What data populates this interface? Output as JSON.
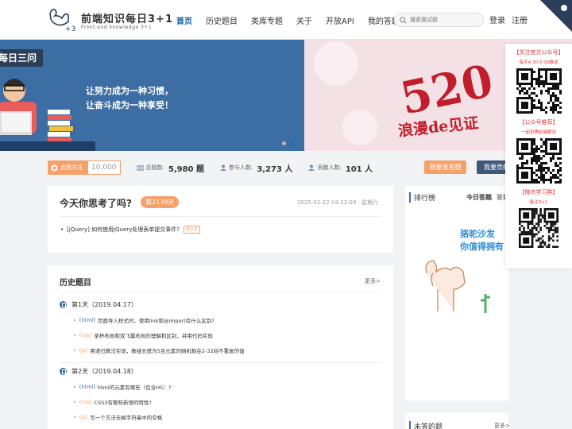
{
  "header": {
    "logo_title": "前端知识每日3+1",
    "logo_subtitle": "Front-end knowledge 3+1",
    "nav": [
      "首页",
      "历史题目",
      "类库专题",
      "关于",
      "开放API",
      "我的答题"
    ],
    "search_placeholder": "搜索面试题",
    "login": "登录",
    "register": "注册"
  },
  "banner": {
    "left_title": "每日三问",
    "slogan_1": "让努力成为一种习惯，",
    "slogan_2": "让奋斗成为一种享受！",
    "right_big": "520",
    "right_sub": "浪漫de见证"
  },
  "stats": {
    "follow_label": "点赞关注",
    "follow_count": "10,000",
    "total_label": "总题数:",
    "total_value": "5,980 题",
    "participants_label": "参与人数:",
    "participants_value": "3,273 人",
    "contributors_label": "贡献人数:",
    "contributors_value": "101 人",
    "submit_btn": "我要发答题",
    "contribute_btn": "我要贡献"
  },
  "today": {
    "title": "今天你思考了吗?",
    "days_badge": "第2139天",
    "datetime": "2025-02-22 04:33:09",
    "weekday": "星期六",
    "question_tag": "[jQuery]",
    "question": "如何使用jQuery处理表单提交事件?",
    "pending": "待沙发"
  },
  "history": {
    "title": "历史题目",
    "more": "更多>",
    "days": [
      {
        "label": "第1天（2019.04.17）",
        "questions": [
          {
            "tag": "[html]",
            "text": "页面导入样式时，使用link和@import有什么区别?",
            "color": "#3d6ea3"
          },
          {
            "tag": "[css]",
            "text": "圣杯布局和双飞翼布局的理解和区别，并用代码实现",
            "color": "#f6a06a"
          },
          {
            "tag": "[js]",
            "text": "用递归算法实现，数组长度为5且元素的随机数在2-32间不重复的值",
            "color": "#f6a06a"
          }
        ]
      },
      {
        "label": "第2天（2019.04.18）",
        "questions": [
          {
            "tag": "[html]",
            "text": "html的元素有哪些（包含H5）?",
            "color": "#3d6ea3"
          },
          {
            "tag": "[css]",
            "text": "CSS3有哪些新增的特性?",
            "color": "#f6a06a"
          },
          {
            "tag": "[js]",
            "text": "写一个方法去掉字符串中的空格",
            "color": "#f6a06a"
          }
        ]
      }
    ]
  },
  "rank": {
    "title": "排行榜",
    "tab_today": "今日答题",
    "tab_more": "答题",
    "ad_line1": "骆驼沙发",
    "ad_line2": "你值得拥有"
  },
  "unanswered": {
    "title": "未答的题",
    "more": "更多>"
  },
  "sidebar": {
    "official_title": "【关注官方公众号】",
    "official_sub": "每天4:30-5:00推送",
    "recommend_title": "【公众号推荐】",
    "recommend_sub": "一起折腾前端算法",
    "group_title": "【微信学习群】",
    "group_sub": "备注3+1"
  },
  "colors": {
    "primary": "#0b60a8",
    "accent": "#f6a06a",
    "banner_blue": "#3d6ea3",
    "dark_btn": "#3f5778",
    "red": "#e4393c"
  }
}
